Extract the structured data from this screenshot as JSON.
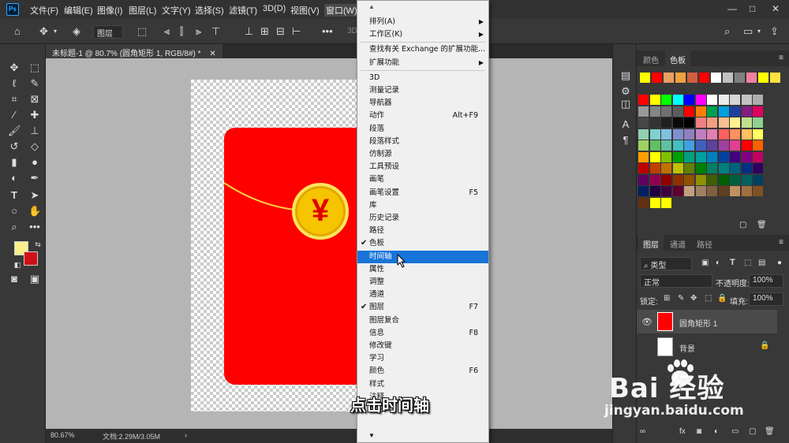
{
  "app": {
    "logo": "Ps"
  },
  "menubar": {
    "items": [
      "文件(F)",
      "编辑(E)",
      "图像(I)",
      "图层(L)",
      "文字(Y)",
      "选择(S)",
      "滤镜(T)",
      "3D(D)",
      "视图(V)",
      "窗口(W)"
    ],
    "window_controls": [
      "—",
      "□",
      "✕"
    ]
  },
  "options_bar": {
    "layer_select": "图层",
    "right_label": "3D"
  },
  "document": {
    "tab_title": "未标题-1 @ 80.7% (圆角矩形 1, RGB/8#) *",
    "currency_symbol": "¥",
    "zoom": "80.67%",
    "doc_size": "文档:2.29M/3.05M"
  },
  "colors": {
    "foreground": "#f8f08a",
    "background": "#d01018",
    "highlight": "#1874d8"
  },
  "swatches_panel": {
    "tabs": [
      "颜色",
      "色板"
    ],
    "active_tab": "色板",
    "recent": [
      "#ffff00",
      "#ff0000",
      "#e8a060",
      "#f0a040",
      "#d06040",
      "#ff0000",
      "#ffffff",
      "#c0c0c0",
      "#808080",
      "#f080a0",
      "#ffff00",
      "#ffe040"
    ],
    "grid": [
      [
        "#ff0000",
        "#ffff00",
        "#00ff00",
        "#00ffff",
        "#0000ff",
        "#ff00ff",
        "#ffffff",
        "#ebebeb",
        "#d6d6d6",
        "#c2c2c2",
        "#adadad"
      ],
      [
        "#999999",
        "#858585",
        "#707070",
        "#5c5c5c",
        "#ff0000",
        "#ff8000",
        "#00a050",
        "#00a0e0",
        "#2040a0",
        "#802080",
        "#e00060"
      ],
      [
        "#474747",
        "#333333",
        "#1f1f1f",
        "#0a0a0a",
        "#000000",
        "#f08080",
        "#f0a080",
        "#f8c090",
        "#fff090",
        "#c0e090",
        "#90d090"
      ],
      [
        "#90d0b0",
        "#80d0d0",
        "#80c0e0",
        "#8090d0",
        "#9080c0",
        "#c080c0",
        "#e080b0",
        "#ff6060",
        "#ff9060",
        "#ffc060",
        "#ffff60"
      ],
      [
        "#a0d060",
        "#60c060",
        "#60c0a0",
        "#40c0c0",
        "#40a0e0",
        "#4060c0",
        "#6040a0",
        "#a040a0",
        "#e04090",
        "#ff0000",
        "#ff6000"
      ],
      [
        "#ffa000",
        "#ffff00",
        "#80c000",
        "#00a000",
        "#00a080",
        "#00a0a0",
        "#0080c0",
        "#0040a0",
        "#400080",
        "#800080",
        "#c00060"
      ],
      [
        "#c00000",
        "#c04000",
        "#c07000",
        "#c0c000",
        "#608000",
        "#008000",
        "#008060",
        "#008080",
        "#006080",
        "#003080",
        "#300060"
      ],
      [
        "#600060",
        "#900050",
        "#900000",
        "#903000",
        "#905000",
        "#909000",
        "#406000",
        "#006000",
        "#006040",
        "#006060",
        "#004060"
      ],
      [
        "#002060",
        "#200040",
        "#400040",
        "#600030",
        "#c0a080",
        "#a08060",
        "#806040",
        "#604020",
        "#c09060",
        "#a07040",
        "#805020"
      ],
      [
        "#603010",
        "#ffff00",
        "#ffff00"
      ]
    ]
  },
  "layers_panel": {
    "tabs": [
      "图层",
      "通道",
      "路径"
    ],
    "active_tab": "图层",
    "filter": "类型",
    "blend_mode": "正常",
    "opacity_label": "不透明度:",
    "opacity": "100%",
    "lock_label": "锁定:",
    "fill_label": "填充:",
    "fill": "100%",
    "layers": [
      {
        "name": "圆角矩形 1",
        "selected": true,
        "visible": true
      },
      {
        "name": "背景",
        "selected": false,
        "visible": false,
        "locked": true
      }
    ]
  },
  "window_menu": {
    "top_arrow": "▲",
    "bottom_arrow": "▼",
    "items": [
      {
        "label": "排列(A)",
        "submenu": true
      },
      {
        "label": "工作区(K)",
        "submenu": true
      },
      {
        "separator": true
      },
      {
        "label": "查找有关 Exchange 的扩展功能..."
      },
      {
        "label": "扩展功能",
        "submenu": true
      },
      {
        "separator": true
      },
      {
        "label": "3D"
      },
      {
        "label": "测量记录"
      },
      {
        "label": "导航器"
      },
      {
        "label": "动作",
        "shortcut": "Alt+F9"
      },
      {
        "label": "段落"
      },
      {
        "label": "段落样式"
      },
      {
        "label": "仿制源"
      },
      {
        "label": "工具预设"
      },
      {
        "label": "画笔"
      },
      {
        "label": "画笔设置",
        "shortcut": "F5"
      },
      {
        "label": "库"
      },
      {
        "label": "历史记录"
      },
      {
        "label": "路径"
      },
      {
        "label": "色板",
        "checked": true
      },
      {
        "label": "时间轴",
        "highlighted": true
      },
      {
        "label": "属性"
      },
      {
        "label": "调整"
      },
      {
        "label": "通道"
      },
      {
        "label": "图层",
        "checked": true,
        "shortcut": "F7"
      },
      {
        "label": "图层复合"
      },
      {
        "label": "信息",
        "shortcut": "F8"
      },
      {
        "label": "修改键"
      },
      {
        "label": "学习"
      },
      {
        "label": "颜色",
        "shortcut": "F6"
      },
      {
        "label": "样式"
      },
      {
        "label": "注释"
      },
      {
        "label": "字符"
      }
    ]
  },
  "subtitle": "点击时间轴",
  "watermark": {
    "brand": "Bai 经验",
    "url": "jingyan.baidu.com"
  }
}
